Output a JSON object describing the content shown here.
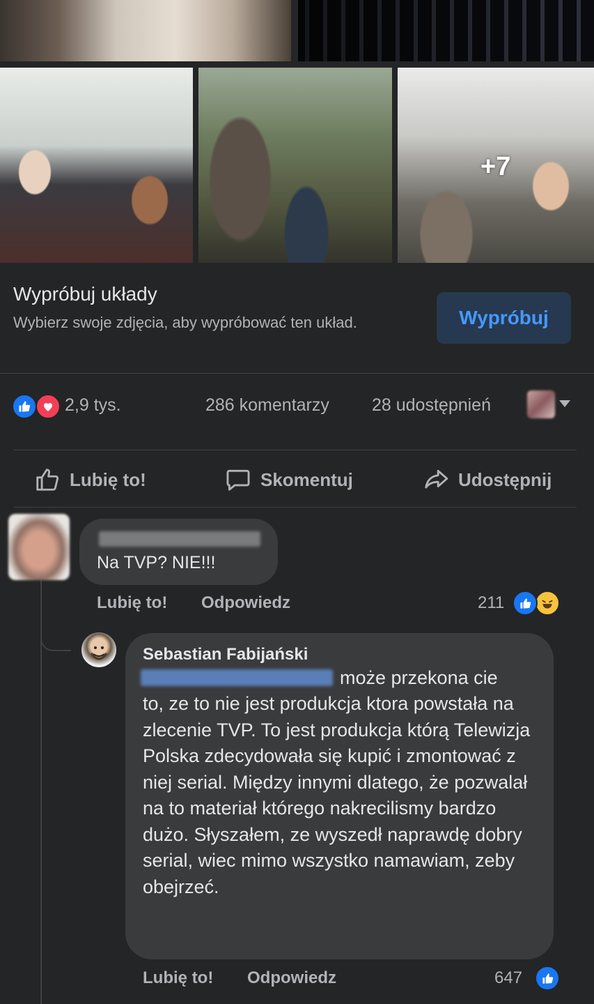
{
  "gallery": {
    "more_count": "+7"
  },
  "layouts_promo": {
    "title": "Wypróbuj układy",
    "subtitle": "Wybierz swoje zdjęcia, aby wypróbować ten układ.",
    "button_label": "Wypróbuj"
  },
  "post_stats": {
    "reactions_count": "2,9 tys.",
    "comments_count": "286 komentarzy",
    "shares_count": "28 udostępnień",
    "reaction_icons": [
      "like-icon",
      "love-icon"
    ]
  },
  "actions": {
    "like_label": "Lubię to!",
    "comment_label": "Skomentuj",
    "share_label": "Udostępnij"
  },
  "comments": [
    {
      "text": "Na TVP? NIE!!!",
      "like_label": "Lubię to!",
      "reply_label": "Odpowiedz",
      "reactions_count": "211",
      "reaction_icons": [
        "like-icon",
        "haha-icon"
      ]
    }
  ],
  "reply": {
    "author": "Sebastian Fabijański",
    "text_first_line": "może przekona cie",
    "text_rest": "to, ze to nie jest produkcja ktora powstała na zlecenie TVP. To jest produkcja którą Telewizja Polska zdecydowała się kupić i zmontować z niej serial. Między innymi dlatego, że pozwalał na to materiał którego nakrecilismy bardzo dużo. Słyszałem, ze wyszedł naprawdę dobry serial, wiec mimo wszystko namawiam, zeby obejrzeć.",
    "like_label": "Lubię to!",
    "reply_label": "Odpowiedz",
    "reactions_count": "647",
    "reaction_icons": [
      "like-icon"
    ]
  },
  "colors": {
    "background": "#242526",
    "bubble": "#3a3b3c",
    "text_primary": "#e4e6eb",
    "text_secondary": "#b0b3b8",
    "accent_blue": "#4599ff",
    "like_blue": "#1877f2",
    "love_red": "#f33e58"
  }
}
